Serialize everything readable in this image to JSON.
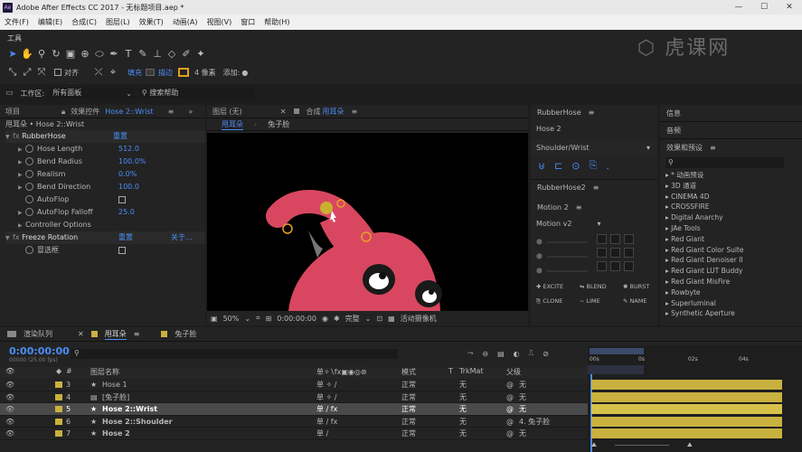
{
  "app": {
    "title": "Adobe After Effects CC 2017 - 无标题项目.aep *",
    "logo": "Ae",
    "min": "—",
    "max": "☐",
    "close": "✕"
  },
  "menu": [
    "文件(F)",
    "编辑(E)",
    "合成(C)",
    "图层(L)",
    "效果(T)",
    "动画(A)",
    "视图(V)",
    "窗口",
    "帮助(H)"
  ],
  "toolsbar": {
    "label": "工具",
    "align": "对齐",
    "fill": "填充",
    "stroke": "描边",
    "stroke_width": "4 像素",
    "add": "添加:",
    "workspace_label": "工作区:",
    "workspace_value": "所有面板",
    "search_help": "搜索帮助"
  },
  "watermark": "虎课网",
  "effects_panel": {
    "project_tab": "项目",
    "title": "效果控件",
    "layer": "Hose 2::Wrist",
    "subtitle": "甩耳朵 • Hose 2::Wrist",
    "effect1": {
      "name": "RubberHose",
      "reset": "重置"
    },
    "props": [
      {
        "name": "Hose Length",
        "value": "512.0"
      },
      {
        "name": "Bend Radius",
        "value": "100.0%"
      },
      {
        "name": "Realism",
        "value": "0.0%"
      },
      {
        "name": "Bend Direction",
        "value": "100.0"
      },
      {
        "name": "AutoFlop",
        "value": ""
      },
      {
        "name": "AutoFlop Falloff",
        "value": "25.0"
      },
      {
        "name": "Controller Options",
        "value": ""
      }
    ],
    "effect2": {
      "name": "Freeze Rotation",
      "reset": "重置",
      "about": "关于...",
      "prop": "冒选框"
    }
  },
  "viewer": {
    "layer_tab": "图层 (无)",
    "comp_prefix": "合成",
    "comp_name": "甩耳朵",
    "breadcrumb": [
      "甩耳朵",
      "兔子脸"
    ],
    "zoom": "50%",
    "timecode": "0:00:00:00",
    "quality": "完整",
    "camera": "活动摄像机"
  },
  "rubberhose": {
    "title": "RubberHose",
    "name1": "Hose 2",
    "dropdown": "Shoulder/Wrist",
    "title2": "RubberHose2",
    "motion_title": "Motion 2",
    "motion_value": "Motion v2",
    "actions": [
      "EXCITE",
      "BLEND",
      "BURST",
      "CLONE",
      "LIME",
      "NAME"
    ]
  },
  "right_panel": {
    "info": "信息",
    "audio": "音频",
    "effects_title": "效果和预设",
    "items": [
      "▸ * 动画预设",
      "▸ 3D 通道",
      "▸ CINEMA 4D",
      "▸ CROSSFIRE",
      "▸ Digital Anarchy",
      "▸ JAe Tools",
      "▸ Red Giant",
      "▸ Red Giant Color Suite",
      "▸ Red Giant Denoiser II",
      "▸ Red Giant LUT Buddy",
      "▸ Red Giant MisFire",
      "▸ Rowbyte",
      "▸ Superluminal",
      "▸ Synthetic Aperture"
    ]
  },
  "timeline": {
    "tabs": [
      "渲染队列",
      "甩耳朵",
      "兔子脸"
    ],
    "timecode": "0:00:00:00",
    "fps": "00000 (25.00 fps)",
    "col_name": "图层名称",
    "col_mode": "模式",
    "col_t": "T",
    "col_trk": "TrkMat",
    "col_parent": "父级",
    "ruler": [
      "0s",
      "02s",
      "04s"
    ],
    "ruler_start": "00s",
    "rows": [
      {
        "num": "3",
        "name": "Hose 1",
        "mode": "正常",
        "trk": "无",
        "parent": "无",
        "selected": false
      },
      {
        "num": "4",
        "name": "[兔子脸]",
        "mode": "正常",
        "trk": "无",
        "parent": "无",
        "selected": false
      },
      {
        "num": "5",
        "name": "Hose 2::Wrist",
        "mode": "正常",
        "trk": "无",
        "parent": "无",
        "selected": true
      },
      {
        "num": "6",
        "name": "Hose 2::Shoulder",
        "mode": "正常",
        "trk": "无",
        "parent": "4. 兔子脸",
        "selected": false
      },
      {
        "num": "7",
        "name": "Hose 2",
        "mode": "正常",
        "trk": "无",
        "parent": "无",
        "selected": false
      }
    ]
  },
  "colors": {
    "accent": "#4b8df8",
    "label_yellow": "#c9b13f",
    "character_pink": "#d8475f",
    "dark_panel": "#232323"
  }
}
